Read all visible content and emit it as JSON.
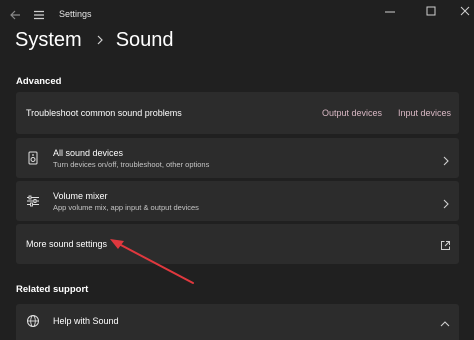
{
  "window": {
    "title": "Settings",
    "back_icon": "back-arrow-icon",
    "menu_icon": "hamburger-menu-icon",
    "controls": [
      "minimize-icon",
      "maximize-icon",
      "close-icon"
    ]
  },
  "breadcrumb": {
    "parent": "System",
    "current": "Sound"
  },
  "advanced": {
    "heading": "Advanced",
    "troubleshoot": {
      "label": "Troubleshoot common sound problems",
      "output_link": "Output devices",
      "input_link": "Input devices"
    },
    "all_devices": {
      "title": "All sound devices",
      "subtitle": "Turn devices on/off, troubleshoot, other options",
      "icon": "speaker-device-icon"
    },
    "volume_mixer": {
      "title": "Volume mixer",
      "subtitle": "App volume mix, app input & output devices",
      "icon": "sliders-mixer-icon"
    },
    "more_settings": {
      "title": "More sound settings",
      "icon": "external-link-icon"
    }
  },
  "related": {
    "heading": "Related support",
    "help": {
      "title": "Help with Sound",
      "icon": "globe-icon"
    }
  },
  "colors": {
    "background": "#202020",
    "card": "#2c2c2c",
    "link": "#d9b8c4",
    "annotation_arrow": "#e0383e"
  }
}
